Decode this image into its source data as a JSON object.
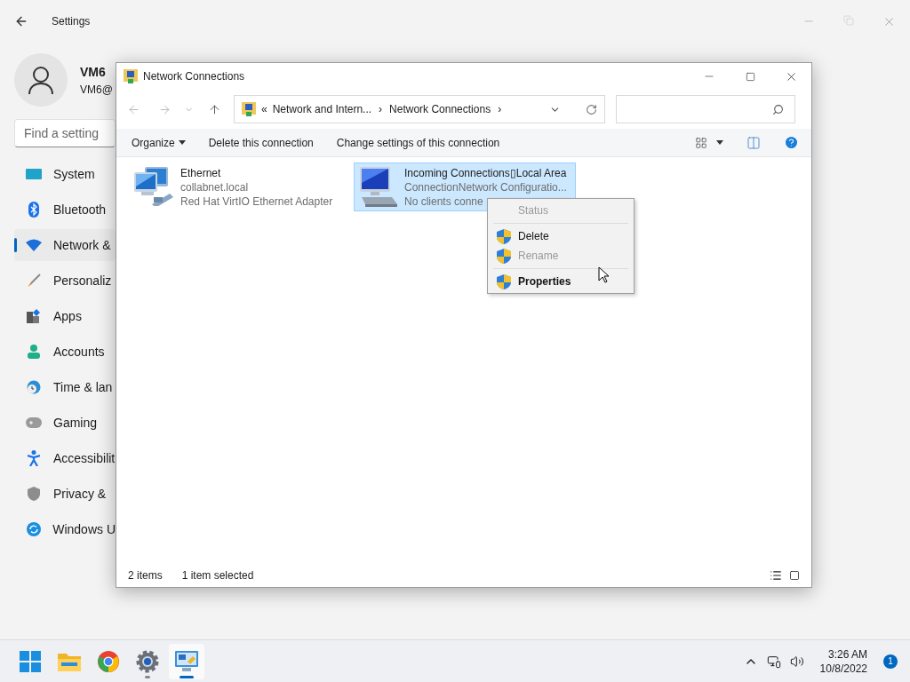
{
  "settings": {
    "title": "Settings",
    "user": {
      "name": "VM6",
      "email": "VM6@"
    },
    "search": {
      "placeholder": "Find a setting"
    },
    "nav": [
      {
        "label": "System",
        "selected": false
      },
      {
        "label": "Bluetooth",
        "selected": false
      },
      {
        "label": "Network &",
        "selected": true
      },
      {
        "label": "Personaliz",
        "selected": false
      },
      {
        "label": "Apps",
        "selected": false
      },
      {
        "label": "Accounts",
        "selected": false
      },
      {
        "label": "Time & lan",
        "selected": false
      },
      {
        "label": "Gaming",
        "selected": false
      },
      {
        "label": "Accessibilit",
        "selected": false
      },
      {
        "label": "Privacy &",
        "selected": false
      },
      {
        "label": "Windows U",
        "selected": false
      }
    ]
  },
  "explorer": {
    "title": "Network Connections",
    "breadcrumb": {
      "prefix": "«",
      "parts": [
        "Network and Intern...",
        "Network Connections"
      ],
      "separator": "›"
    },
    "toolbar": [
      {
        "label": "Organize",
        "dropdown": true
      },
      {
        "label": "Delete this connection",
        "dropdown": false
      },
      {
        "label": "Change settings of this connection",
        "dropdown": false
      }
    ],
    "items": [
      {
        "kind": "ethernet",
        "selected": false,
        "lines": [
          "Ethernet",
          "collabnet.local",
          "Red Hat VirtIO Ethernet Adapter"
        ]
      },
      {
        "kind": "incoming",
        "selected": true,
        "lines": [
          "Incoming Connections▯Local Area",
          "ConnectionNetwork Configuratio...",
          "No clients conne"
        ]
      }
    ],
    "context_menu": [
      {
        "label": "Status",
        "shield": false,
        "disabled": true,
        "bold": false,
        "divider_after": true
      },
      {
        "label": "Delete",
        "shield": true,
        "disabled": false,
        "bold": false,
        "divider_after": false
      },
      {
        "label": "Rename",
        "shield": true,
        "disabled": true,
        "bold": false,
        "divider_after": true
      },
      {
        "label": "Properties",
        "shield": true,
        "disabled": false,
        "bold": true,
        "divider_after": false
      }
    ],
    "status_bar": {
      "count": "2 items",
      "selection": "1 item selected"
    }
  },
  "taskbar": {
    "apps": [
      {
        "running": false,
        "active": false
      },
      {
        "running": false,
        "active": false
      },
      {
        "running": false,
        "active": false
      },
      {
        "running": true,
        "active": false
      },
      {
        "running": true,
        "active": true
      }
    ],
    "time": "3:26 AM",
    "date": "10/8/2022",
    "notifications": "1"
  }
}
